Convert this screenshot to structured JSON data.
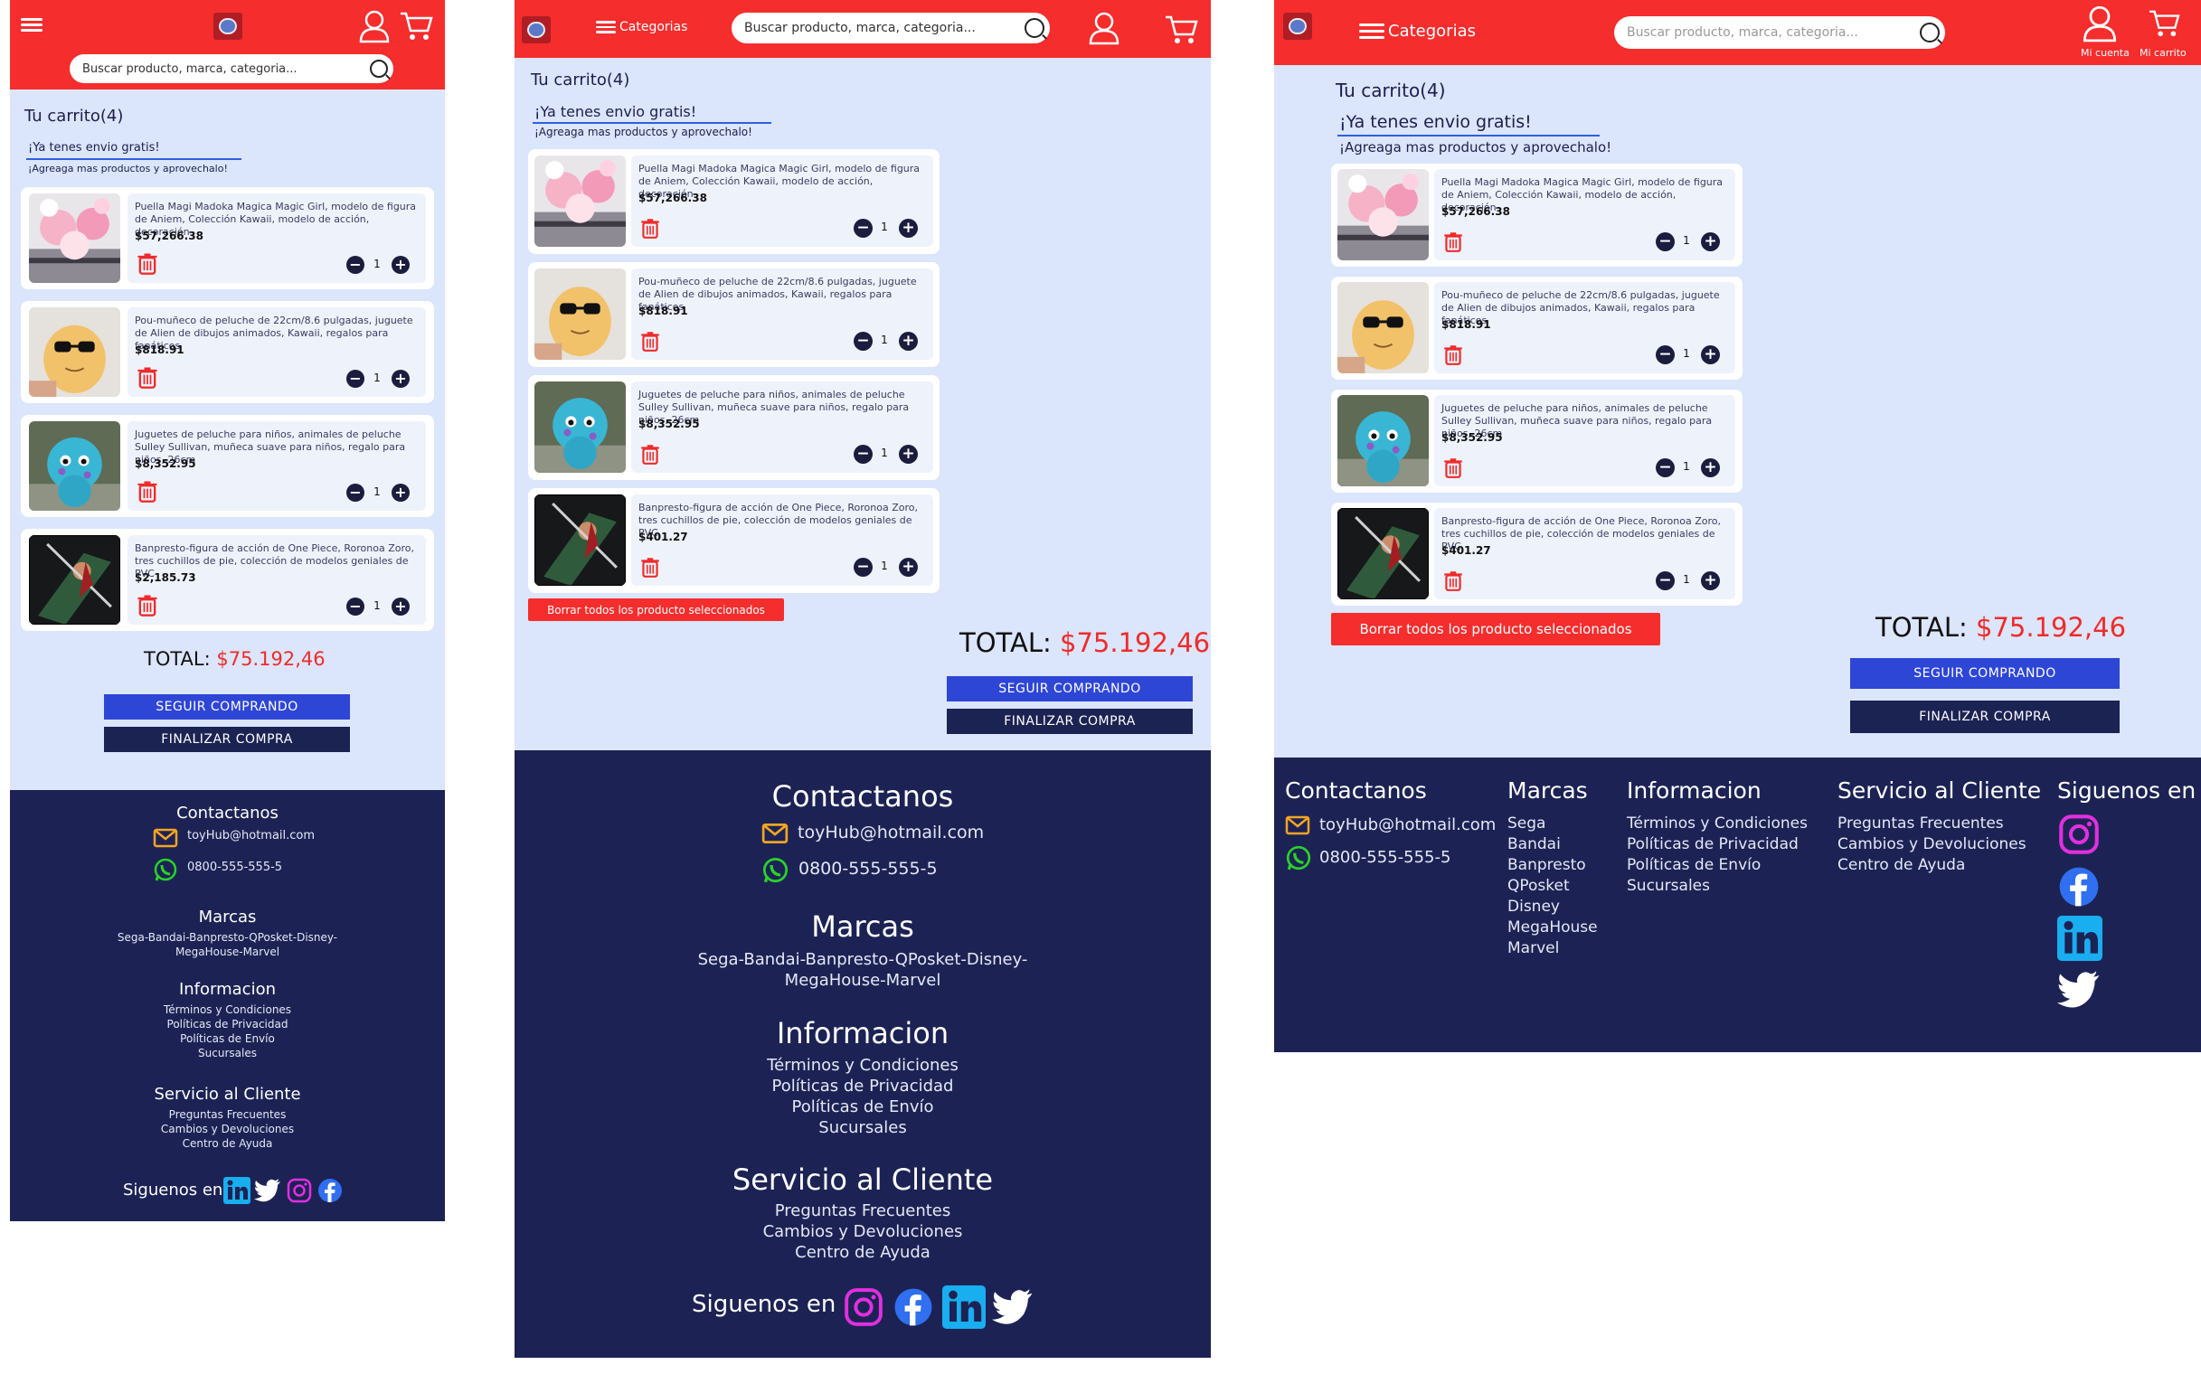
{
  "header": {
    "search_placeholder": "Buscar producto, marca, categoria...",
    "categories_label": "Categorias",
    "account_label": "Mi cuenta",
    "cart_label": "Mi carrito"
  },
  "cart": {
    "title": "Tu carrito(4)",
    "free_shipping": "¡Ya tenes envio gratis!",
    "free_shipping_sub": "¡Agreaga mas productos y aprovechalo!",
    "delete_selected_label": "Borrar todos los producto seleccionados",
    "total_label": "TOTAL:",
    "total_value": "$75.192,46",
    "continue_label": "SEGUIR COMPRANDO",
    "checkout_label": "FINALIZAR COMPRA",
    "items": [
      {
        "name": "Puella Magi Madoka Magica Magic Girl, modelo de figura de Aniem, Colección Kawaii, modelo de acción, decoración",
        "price": "$57,266.38",
        "qty": "1"
      },
      {
        "name": "Pou-muñeco de peluche de 22cm/8.6 pulgadas, juguete de Alien de dibujos animados, Kawaii, regalos para fanáticos",
        "price": "$818.91",
        "qty": "1"
      },
      {
        "name": "Juguetes de peluche para niños, animales de peluche Sulley Sullivan, muñeca suave para niños, regalo para niños, 26cm",
        "price": "$8,352.95",
        "qty": "1"
      },
      {
        "name": "Banpresto-figura de acción de One Piece, Roronoa Zoro, tres cuchillos de pie, colección de modelos geniales de PVC",
        "price": "$401.27",
        "price_mobile": "$2,185.73",
        "qty": "1"
      }
    ]
  },
  "footer": {
    "contact_title": "Contactanos",
    "email": "toyHub@hotmail.com",
    "phone": "0800-555-555-5",
    "brands_title": "Marcas",
    "brands_line1": "Sega-Bandai-Banpresto-QPosket-Disney-",
    "brands_line2": "MegaHouse-Marvel",
    "brands": [
      "Sega",
      "Bandai",
      "Banpresto",
      "QPosket",
      "Disney",
      "MegaHouse",
      "Marvel"
    ],
    "info_title": "Informacion",
    "info_links": [
      "Términos y Condiciones",
      "Políticas de Privacidad",
      "Políticas de Envío",
      "Sucursales"
    ],
    "service_title": "Servicio al Cliente",
    "service_links": [
      "Preguntas Frecuentes",
      "Cambios y Devoluciones",
      "Centro de Ayuda"
    ],
    "follow_label": "Siguenos en"
  },
  "colors": {
    "header_red": "#f52d2d",
    "page_bg": "#dbe5fb",
    "footer_navy": "#1c2354",
    "continue_blue": "#2e46d6",
    "checkout_navy": "#1b2353",
    "total_red": "#ef2b2b",
    "instagram": "#e12fe0",
    "facebook": "#2f6ff0",
    "linkedin": "#19aef0",
    "whatsapp": "#2bd12b",
    "email_icon": "#f4a423"
  },
  "icons": [
    "menu-icon",
    "search-icon",
    "user-icon",
    "cart-icon",
    "trash-icon",
    "minus-icon",
    "plus-icon",
    "email-icon",
    "whatsapp-icon",
    "instagram-icon",
    "facebook-icon",
    "linkedin-icon",
    "twitter-icon"
  ]
}
